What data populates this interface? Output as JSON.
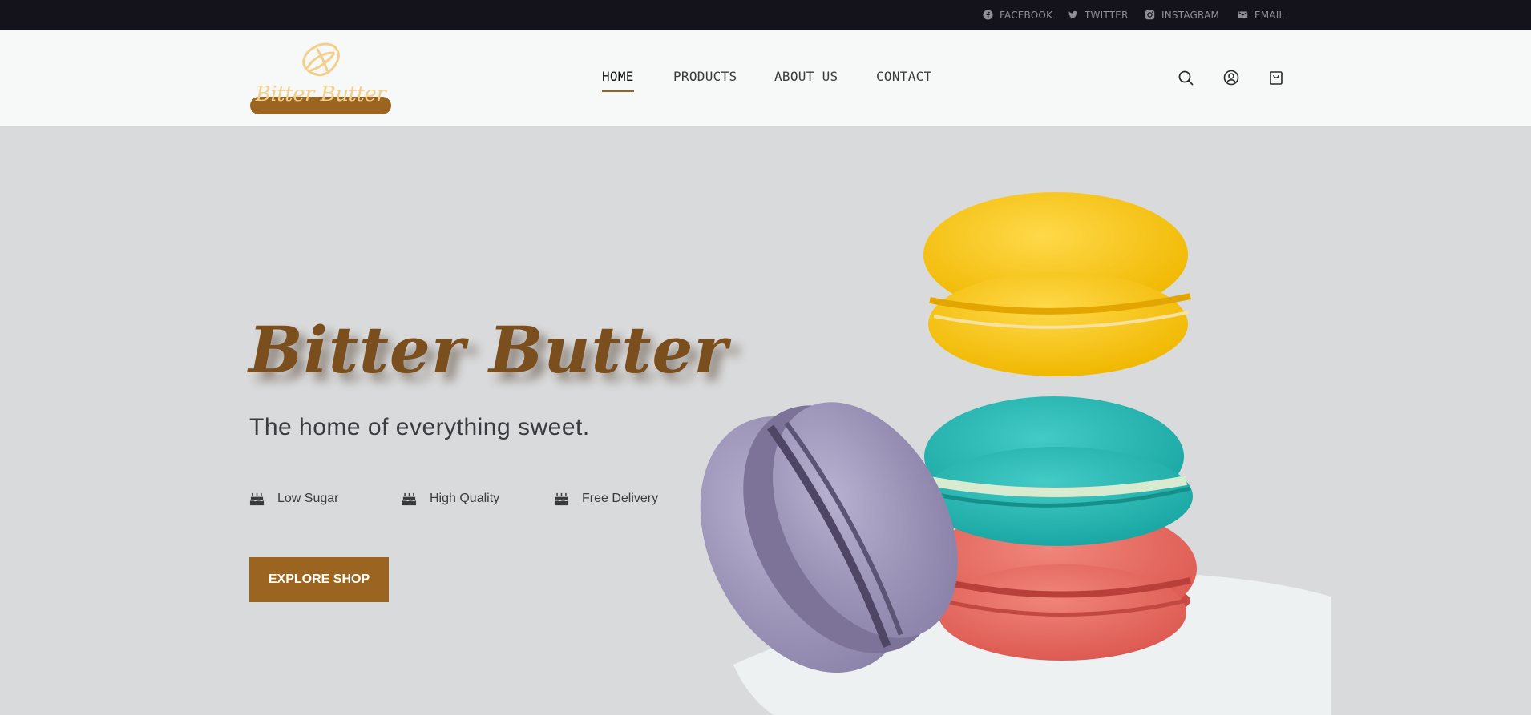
{
  "topbar": {
    "links": [
      {
        "label": "FACEBOOK",
        "icon": "facebook-icon"
      },
      {
        "label": "TWITTER",
        "icon": "twitter-icon"
      },
      {
        "label": "INSTAGRAM",
        "icon": "instagram-icon"
      },
      {
        "label": "EMAIL",
        "icon": "mail-icon"
      }
    ]
  },
  "header": {
    "logo_text": "Bitter Butter",
    "nav": [
      {
        "label": "HOME",
        "active": true
      },
      {
        "label": "PRODUCTS"
      },
      {
        "label": "ABOUT US"
      },
      {
        "label": "CONTACT"
      }
    ],
    "icons": [
      "search-icon",
      "account-icon",
      "cart-icon"
    ]
  },
  "hero": {
    "title": "Bitter Butter",
    "subtitle": "The home of everything sweet.",
    "features": [
      {
        "label": "Low Sugar",
        "icon": "cake-icon"
      },
      {
        "label": "High Quality",
        "icon": "cake-icon"
      },
      {
        "label": "Free Delivery",
        "icon": "cake-icon"
      }
    ],
    "cta_label": "EXPLORE SHOP"
  },
  "colors": {
    "topbar_bg": "#14121a",
    "header_bg": "#f7f8f8",
    "hero_bg": "#d9dadb",
    "brand_brown": "#9b6421",
    "title_brown": "#7a4e1d",
    "logo_gold": "#f4cf8c"
  }
}
